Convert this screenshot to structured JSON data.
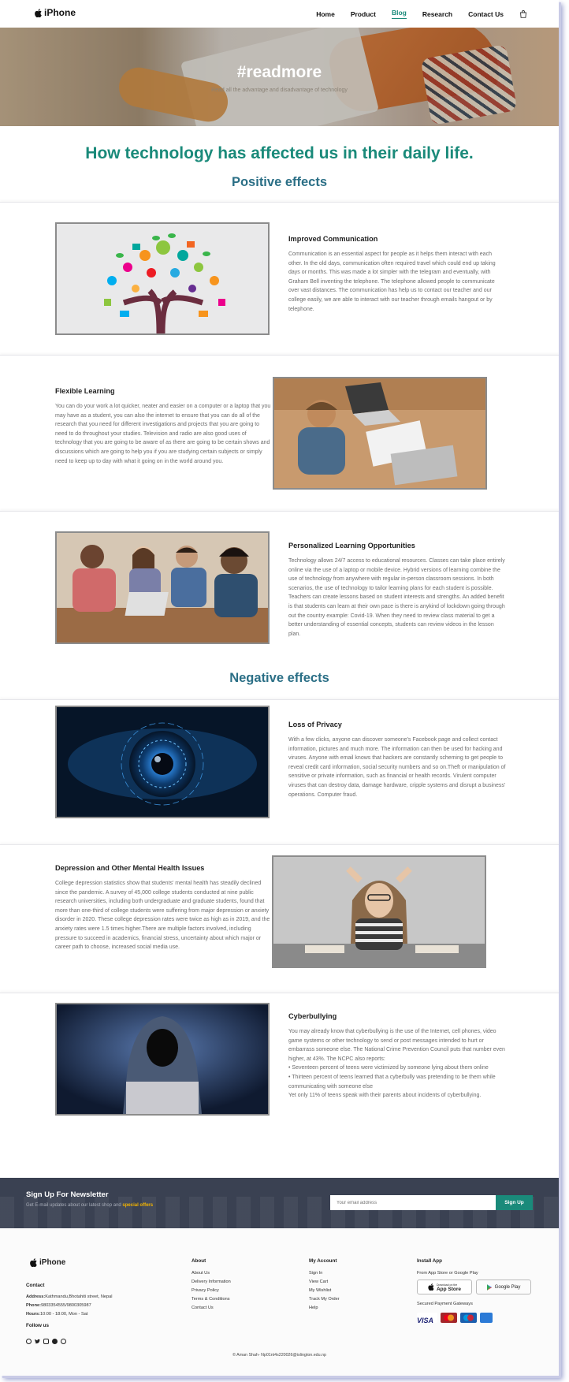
{
  "nav": {
    "brand": "iPhone",
    "items": [
      "Home",
      "Product",
      "Blog",
      "Research",
      "Contact Us"
    ],
    "active": "Blog"
  },
  "hero": {
    "title": "#readmore",
    "subtitle": "Read all the advantage and disadvantage of technology"
  },
  "main_title": "How technology has affected us in their daily life.",
  "positive_title": "Positive effects",
  "negative_title": "Negative effects",
  "articles": [
    {
      "title": "Improved Communication",
      "text": "Communication is an essential aspect for people as it helps them interact with each other. In the old days, communication often required travel which could end up taking days or months. This was made a lot simpler with the telegram and eventually, with Graham Bell inventing the telephone. The telephone allowed people to communicate over vast distances. The communication has help us to contact our teacher and our college easily, we are able to interact with our teacher through emails hangout or by telephone.",
      "image": "communication-tree-illustration"
    },
    {
      "title": "Flexible Learning",
      "text": "You can do your work a lot quicker, neater and easier on a computer or a laptop that you may have as a student, you can also the internet to ensure that you can do all of the research that you need for different investigations and projects that you are going to need to do throughout your studies. Television and radio are also good uses of technology that you are going to be aware of as there are going to be certain shows and discussions which are going to help you if you are studying certain subjects or simply need to keep up to day with what it going on in the world around you.",
      "image": "student-laptop-photo"
    },
    {
      "title": "Personalized Learning Opportunities",
      "text": "Technology allows 24/7 access to educational resources. Classes can take place entirely online via the use of a laptop or mobile device. Hybrid versions of learning combine the use of technology from anywhere with regular in-person classroom sessions. In both scenarios, the use of technology to tailor learning plans for each student is possible. Teachers can create lessons based on student interests and strengths. An added benefit is that students can learn at their own pace is there is anykind of lockdown going through out the country example: Covid-19. When they need to review class material to get a better understanding of essential concepts, students can review videos in the lesson plan.",
      "image": "group-study-photo"
    },
    {
      "title": "Loss of Privacy",
      "text": "With a few clicks, anyone can discover someone's Facebook page and collect contact information, pictures and much more. The information can then be used for hacking and viruses. Anyone with email knows that hackers are constantly scheming to get people to reveal credit card information, social security numbers and so on.Theft or manipulation of sensitive or private information, such as financial or health records. Virulent computer viruses that can destroy data, damage hardware, cripple systems and disrupt a business' operations. Computer fraud.",
      "image": "digital-eye-photo"
    },
    {
      "title": "Depression and Other Mental Health Issues",
      "text": "College depression statistics show that students' mental health has steadily declined since the pandemic. A survey of 45,000 college students conducted at nine public research universities, including both undergraduate and graduate students, found that more than one-third of college students were suffering from major depression or anxiety disorder in 2020. These college depression rates were twice as high as in 2019, and the anxiety rates were 1.5 times higher.There are multiple factors involved, including pressure to succeed in academics, financial stress, uncertainty about which major or career path to choose, increased social media use.",
      "image": "stressed-student-photo"
    },
    {
      "title": "Cyberbullying",
      "text": "You may already know that cyberbullying is the use of the Internet, cell phones, video game systems or other technology to send or post messages intended to hurt or embarrass someone else. The National Crime Prevention Council puts that number even higher, at 43%. The NCPC also reports:\n• Seventeen percent of teens were victimized by someone lying about them online\n• Thirteen percent of teens learned that a cyberbully was pretending to be them while communicating with someone else\nYet only 11% of teens speak with their parents about incidents of cyberbullying.",
      "image": "hooded-hacker-photo"
    }
  ],
  "newsletter": {
    "title": "Sign Up For Newsletter",
    "subtitle": "Get E-mail updates about our latest shop and ",
    "highlight": "special offers",
    "placeholder": "Your email address",
    "button": "Sign Up"
  },
  "footer": {
    "brand": "iPhone",
    "contact_heading": "Contact",
    "address_label": "Address:",
    "address": "Kathmandu,Bhotahiti street, Nepal",
    "phone_label": "Phone:",
    "phone": "9803354555/9800305987",
    "hours_label": "Hours:",
    "hours": "10:00 - 18:00, Mon - Sat",
    "follow": "Follow us",
    "about_heading": "About",
    "about_links": [
      "About Us",
      "Delivery Information",
      "Privacy Policy",
      "Terms & Conditions",
      "Contact Us"
    ],
    "account_heading": "My Account",
    "account_links": [
      "Sign In",
      "View Cart",
      "My Wishlist",
      "Track My Order",
      "Help"
    ],
    "install_heading": "Install App",
    "install_sub": "From App Store or Google Play",
    "app_store": "App Store",
    "app_store_small": "Download on the",
    "google_play": "Google Play",
    "gateways": "Secured Payment Gateways",
    "cards": [
      "VISA",
      "Mastercard",
      "Maestro",
      "Amex"
    ],
    "copyright": "© Aman Shah- Np01nt4s220026@islington.edu.np"
  },
  "colors": {
    "accent": "#1a8a7a",
    "section_heading": "#2b6f86",
    "newsletter_bg": "#3a4152"
  }
}
